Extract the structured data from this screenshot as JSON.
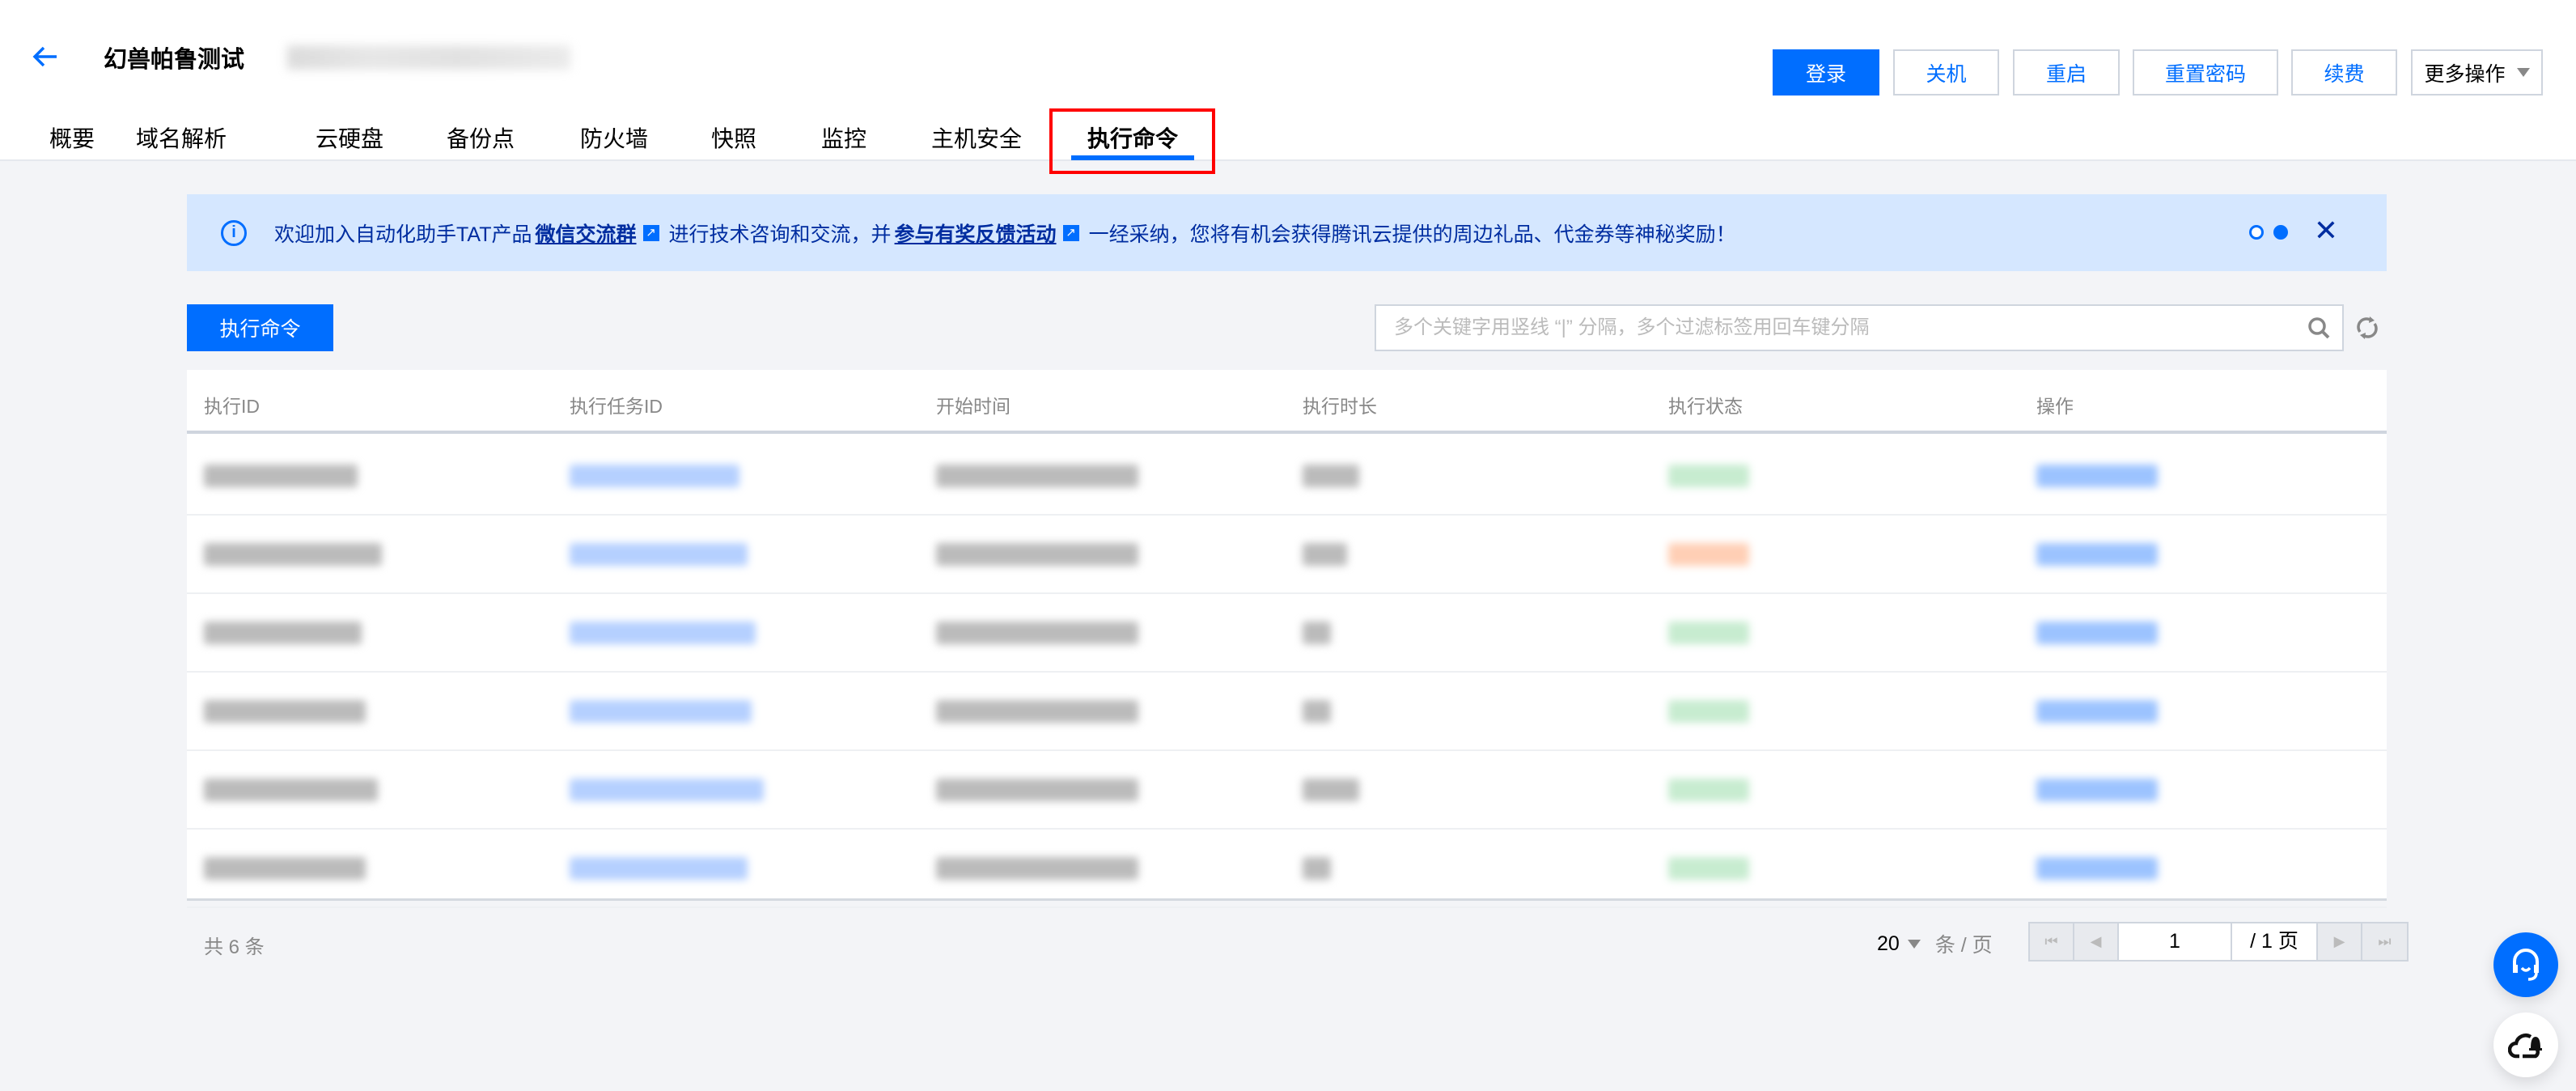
{
  "header": {
    "title": "幻兽帕鲁测试",
    "buttons": {
      "login": "登录",
      "shutdown": "关机",
      "restart": "重启",
      "reset_password": "重置密码",
      "renew": "续费",
      "more": "更多操作"
    },
    "tabs": [
      "概要",
      "域名解析",
      "云硬盘",
      "备份点",
      "防火墙",
      "快照",
      "监控",
      "主机安全",
      "执行命令"
    ],
    "active_tab": "执行命令"
  },
  "banner": {
    "text1": "欢迎加入自动化助手TAT产品",
    "link1": "微信交流群",
    "text2": "进行技术咨询和交流，并",
    "link2": "参与有奖反馈活动",
    "text3": "一经采纳，您将有机会获得腾讯云提供的周边礼品、代金券等神秘奖励！",
    "active_dot": 2
  },
  "toolbar": {
    "run_command": "执行命令",
    "search_placeholder": "多个关键字用竖线 “|” 分隔，多个过滤标签用回车键分隔"
  },
  "table": {
    "columns": [
      "执行ID",
      "执行任务ID",
      "开始时间",
      "执行时长",
      "执行状态",
      "操作"
    ],
    "rows": [
      {
        "status_color": "#2ba471"
      },
      {
        "status_color": "#ff7200"
      },
      {
        "status_color": "#2ba471"
      },
      {
        "status_color": "#2ba471"
      },
      {
        "status_color": "#2ba471"
      },
      {
        "status_color": "#2ba471"
      }
    ]
  },
  "footer": {
    "total": "共 6 条",
    "page_size": "20",
    "page_size_unit": "条 / 页",
    "current_page": "1",
    "total_pages": "/ 1 页"
  },
  "colors": {
    "accent": "#006eff",
    "banner_bg": "#d5e7ff",
    "highlight_box": "#ff0000"
  }
}
